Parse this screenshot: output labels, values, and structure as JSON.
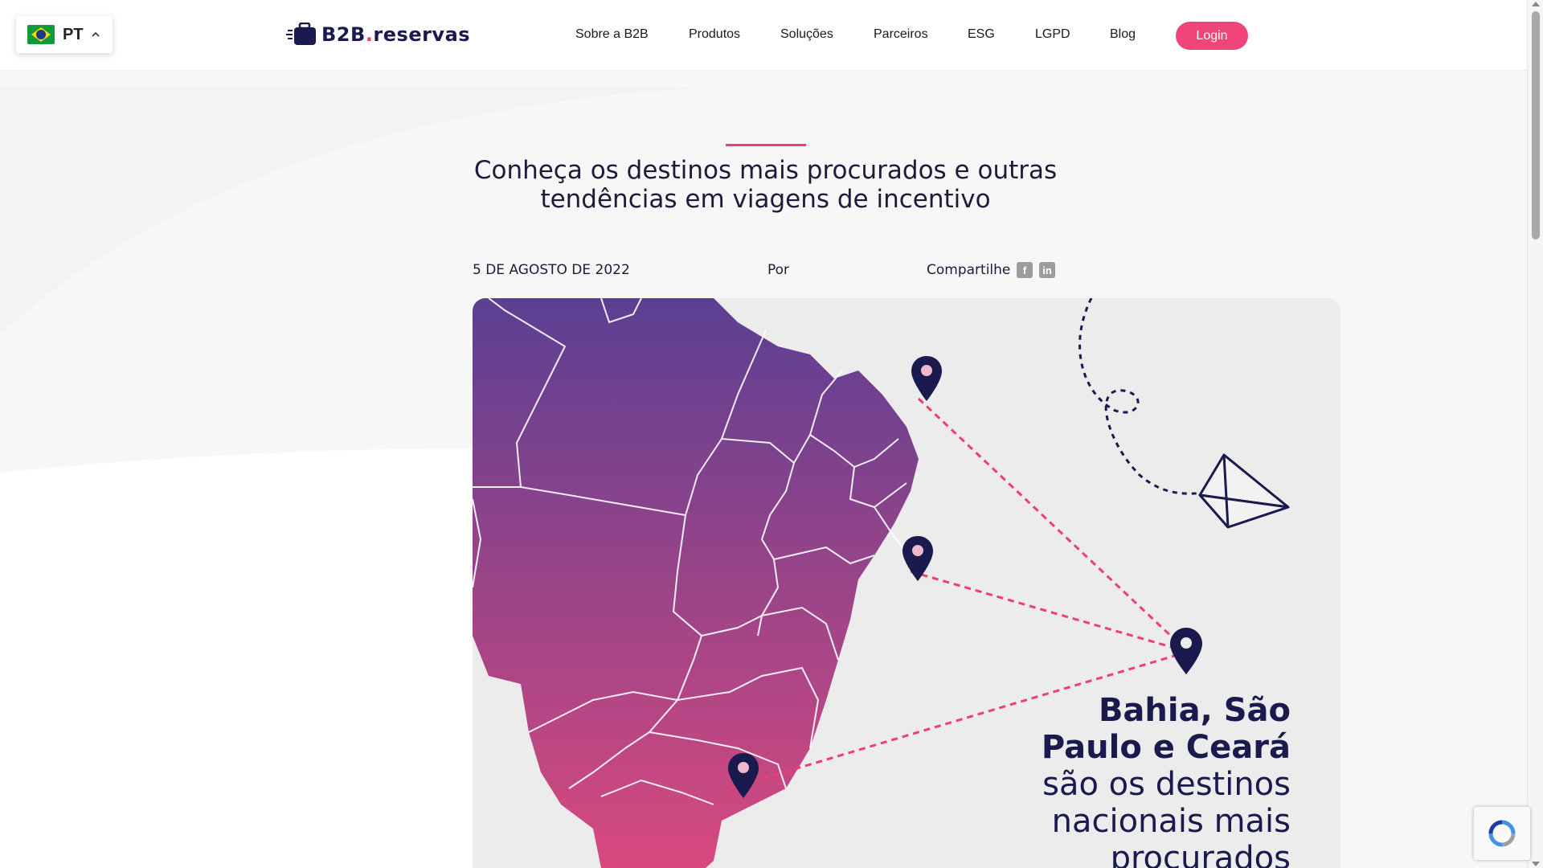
{
  "header": {
    "language": {
      "code": "PT",
      "flag": "brazil-flag-icon"
    },
    "logo": {
      "prefix": "B2B",
      "dot": ".",
      "suffix": "reservas"
    },
    "nav": [
      {
        "label": "Sobre a B2B"
      },
      {
        "label": "Produtos"
      },
      {
        "label": "Soluções"
      },
      {
        "label": "Parceiros"
      },
      {
        "label": "ESG"
      },
      {
        "label": "LGPD"
      },
      {
        "label": "Blog"
      }
    ],
    "login_label": "Login"
  },
  "article": {
    "title": "Conheça os destinos mais procurados e outras tendências em viagens de incentivo",
    "date": "5 DE AGOSTO DE 2022",
    "author_prefix": "Por",
    "share_label": "Compartilhe",
    "share_icons": [
      "facebook-icon",
      "linkedin-icon"
    ]
  },
  "hero": {
    "headline_bold_1": "Bahia, São",
    "headline_bold_2": "Paulo e Ceará",
    "headline_light_1": "são os destinos",
    "headline_light_2": "nacionais mais",
    "headline_light_3": "procurados"
  },
  "colors": {
    "accent": "#ef3f6e",
    "brand_navy": "#1a1a4e",
    "map_top": "#5b3f93",
    "map_bottom": "#d8497e"
  }
}
